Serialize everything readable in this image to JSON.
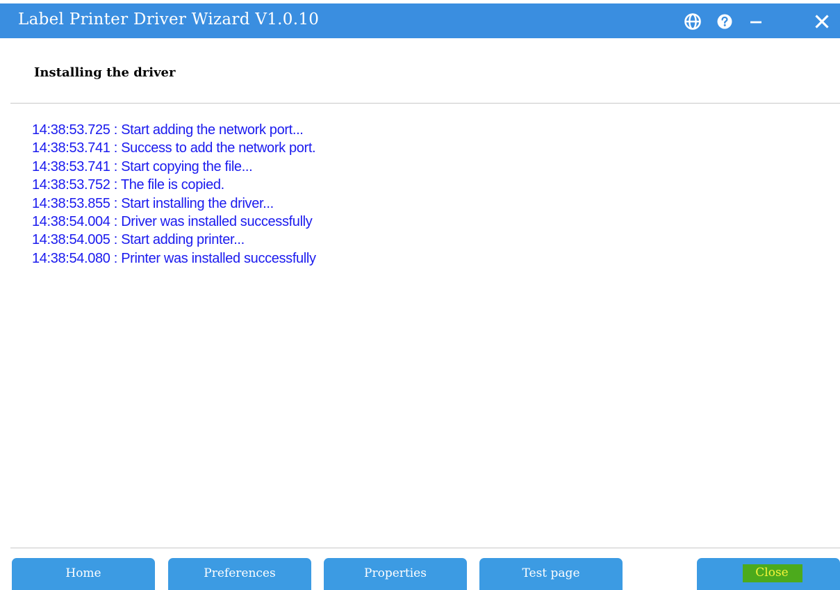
{
  "window": {
    "title": "Label Printer Driver Wizard  V1.0.10",
    "controls": {
      "language_icon": "globe-icon",
      "help_icon": "help-circle-icon",
      "minimize_icon": "minimize-icon",
      "close_icon": "close-icon"
    }
  },
  "page": {
    "heading": "Installing the driver"
  },
  "log": [
    "14:38:53.725 : Start adding the network port...",
    "14:38:53.741 : Success to add the network port.",
    "14:38:53.741 : Start copying the file...",
    "14:38:53.752 : The file is copied.",
    "14:38:53.855 : Start installing the driver...",
    "14:38:54.004 : Driver was installed successfully",
    "14:38:54.005 : Start adding printer...",
    "14:38:54.080 : Printer was installed successfully"
  ],
  "buttons": {
    "home": "Home",
    "preferences": "Preferences",
    "properties": "Properties",
    "test_page": "Test page",
    "close": "Close"
  },
  "colors": {
    "titlebar": "#3a8ee0",
    "button": "#3c9be3",
    "log_text": "#1a1aee",
    "close_highlight": "#4caa1c",
    "close_highlight_text": "#f5f53a"
  }
}
